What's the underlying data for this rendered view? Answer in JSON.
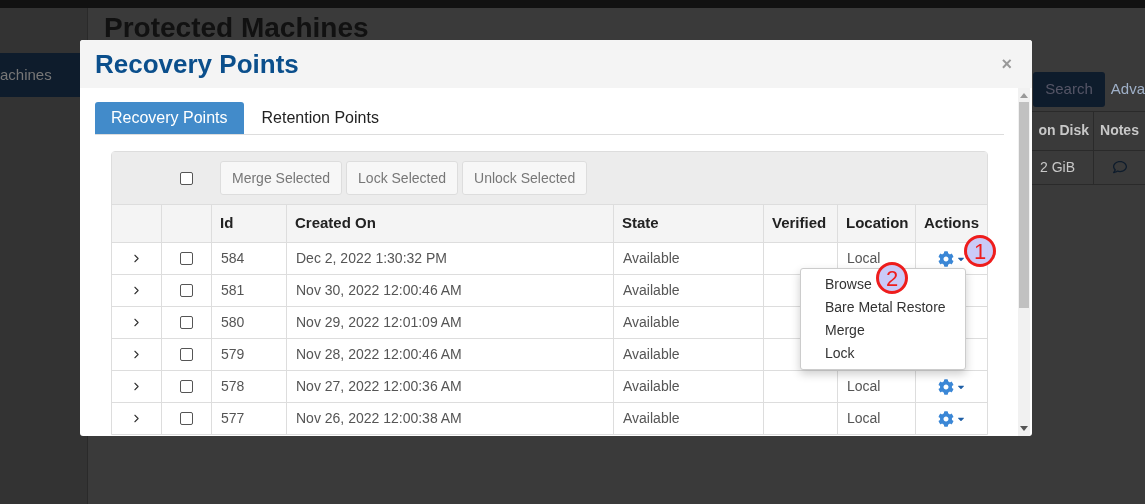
{
  "background_page": {
    "sidebar_item": "achines",
    "heading": "Protected Machines",
    "search_button": "Search",
    "advanced_link": "Adva",
    "table_columns": [
      "on Disk",
      "Notes"
    ],
    "table_cell": "2 GiB"
  },
  "modal": {
    "title": "Recovery Points",
    "close": "×",
    "tabs": [
      {
        "label": "Recovery Points",
        "selected": true
      },
      {
        "label": "Retention Points",
        "selected": false
      }
    ],
    "select_all_checked": false,
    "toolbar_buttons": [
      "Merge Selected",
      "Lock Selected",
      "Unlock Selected"
    ],
    "columns": [
      "Id",
      "Created On",
      "State",
      "Verified",
      "Location",
      "Actions"
    ],
    "rows": [
      {
        "id": "584",
        "created_on": "Dec 2, 2022 1:30:32 PM",
        "state": "Available",
        "location": "Local",
        "checked": false
      },
      {
        "id": "581",
        "created_on": "Nov 30, 2022 12:00:46 AM",
        "state": "Available",
        "checked": false
      },
      {
        "id": "580",
        "created_on": "Nov 29, 2022 12:01:09 AM",
        "state": "Available",
        "checked": false
      },
      {
        "id": "579",
        "created_on": "Nov 28, 2022 12:00:46 AM",
        "state": "Available",
        "checked": false
      },
      {
        "id": "578",
        "created_on": "Nov 27, 2022 12:00:36 AM",
        "state": "Available",
        "location": "Local",
        "checked": false
      },
      {
        "id": "577",
        "created_on": "Nov 26, 2022 12:00:38 AM",
        "state": "Available",
        "location": "Local",
        "checked": false
      }
    ],
    "actions_menu": {
      "items": [
        "Browse",
        "Bare Metal Restore",
        "Merge",
        "Lock"
      ]
    }
  },
  "callouts": [
    "1",
    "2"
  ]
}
